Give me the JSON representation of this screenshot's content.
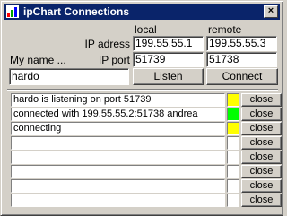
{
  "window": {
    "title": "ipChart Connections",
    "close_glyph": "×"
  },
  "settings": {
    "header_local": "local",
    "header_remote": "remote",
    "ip_address_label": "IP adress",
    "ip_port_label": "IP port",
    "my_name_label": "My name ...",
    "local_ip": "199.55.55.1",
    "remote_ip": "199.55.55.3",
    "local_port": "51739",
    "remote_port": "51738",
    "my_name": "hardo",
    "listen_label": "Listen",
    "connect_label": "Connect"
  },
  "connections": {
    "close_label": "close",
    "rows": [
      {
        "text": "hardo is listening on port 51739",
        "status_color": "#ffff00"
      },
      {
        "text": "connected with 199.55.55.2:51738 andrea",
        "status_color": "#00ff00"
      },
      {
        "text": "connecting",
        "status_color": "#ffff00"
      },
      {
        "text": "",
        "status_color": "#ffffff"
      },
      {
        "text": "",
        "status_color": "#ffffff"
      },
      {
        "text": "",
        "status_color": "#ffffff"
      },
      {
        "text": "",
        "status_color": "#ffffff"
      },
      {
        "text": "",
        "status_color": "#ffffff"
      }
    ]
  },
  "colors": {
    "titlebar": "#0a246a",
    "face": "#d4d0c8",
    "listening": "#ffff00",
    "connected": "#00ff00",
    "idle": "#ffffff"
  },
  "icons": {
    "app": "chart-app-icon",
    "close": "close-icon"
  }
}
